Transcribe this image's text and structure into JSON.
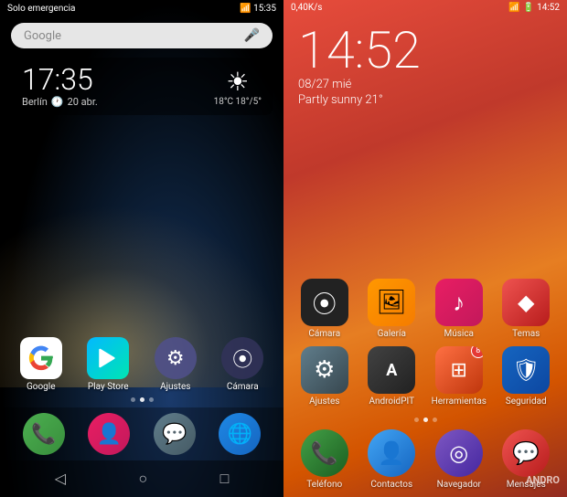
{
  "left": {
    "statusBar": {
      "left": "Solo emergencia",
      "simIcon": "📶",
      "time": "15:35"
    },
    "search": {
      "placeholder": "Google",
      "micIcon": "🎤"
    },
    "clock": {
      "time": "17:35",
      "city": "Berlín",
      "date": "20 abr.",
      "weatherIcon": "☀",
      "tempRange": "18°C 18°/5°"
    },
    "apps": [
      {
        "id": "google",
        "label": "Google",
        "icon": "G",
        "iconClass": "icon-google"
      },
      {
        "id": "playstore",
        "label": "Play Store",
        "icon": "▶",
        "iconClass": "icon-playstore"
      },
      {
        "id": "ajustes",
        "label": "Ajustes",
        "icon": "⚙",
        "iconClass": "icon-settings-left"
      },
      {
        "id": "camara",
        "label": "Cámara",
        "icon": "⦿",
        "iconClass": "icon-camera-left"
      }
    ],
    "dots": [
      {
        "active": false
      },
      {
        "active": true
      },
      {
        "active": false
      }
    ],
    "dock": [
      {
        "id": "phone",
        "icon": "📞",
        "iconClass": "icon-phone-left"
      },
      {
        "id": "contacts",
        "icon": "👤",
        "iconClass": "icon-contacts-left"
      },
      {
        "id": "messages",
        "icon": "💬",
        "iconClass": "icon-messages-left"
      },
      {
        "id": "browser",
        "icon": "🌐",
        "iconClass": "icon-browser-left"
      }
    ],
    "nav": {
      "back": "◁",
      "home": "○",
      "recent": "□"
    }
  },
  "right": {
    "statusBar": {
      "left": "0,40K/s",
      "time": "14:52"
    },
    "clock": {
      "time": "14:52",
      "date": "08/27 mié",
      "weather": "Partly sunny  21°"
    },
    "appsRow1": [
      {
        "id": "camara",
        "label": "Cámara",
        "icon": "⦿",
        "iconClass": "icon-camera-r",
        "badge": null
      },
      {
        "id": "galeria",
        "label": "Galería",
        "icon": "🖼",
        "iconClass": "icon-gallery-r",
        "badge": null
      },
      {
        "id": "musica",
        "label": "Música",
        "icon": "♪",
        "iconClass": "icon-music-r",
        "badge": null
      },
      {
        "id": "temas",
        "label": "Temas",
        "icon": "◆",
        "iconClass": "icon-themes-r",
        "badge": null
      }
    ],
    "appsRow2": [
      {
        "id": "ajustes",
        "label": "Ajustes",
        "icon": "⚙",
        "iconClass": "icon-settings-r",
        "badge": null
      },
      {
        "id": "androidpit",
        "label": "AndroidPIT",
        "icon": "▣",
        "iconClass": "icon-androidpit-r",
        "badge": null
      },
      {
        "id": "herramientas",
        "label": "Herramientas",
        "icon": "⊞",
        "iconClass": "icon-tools-r",
        "badge": "8"
      },
      {
        "id": "seguridad",
        "label": "Seguridad",
        "icon": "🛡",
        "iconClass": "icon-security-r",
        "badge": null
      }
    ],
    "dots": [
      {
        "active": false
      },
      {
        "active": true
      },
      {
        "active": false
      }
    ],
    "appsRow3": [
      {
        "id": "telefono",
        "label": "Teléfono",
        "icon": "📞",
        "iconClass": "icon-phone-r",
        "badge": null
      },
      {
        "id": "contactos",
        "label": "Contactos",
        "icon": "👤",
        "iconClass": "icon-contacts-r",
        "badge": null
      },
      {
        "id": "navegador",
        "label": "Navegador",
        "icon": "◎",
        "iconClass": "icon-browser-r",
        "badge": null
      },
      {
        "id": "mensajes",
        "label": "Mensajes",
        "icon": "💬",
        "iconClass": "icon-sms-r",
        "badge": null
      }
    ],
    "watermark": "ANDRO"
  }
}
